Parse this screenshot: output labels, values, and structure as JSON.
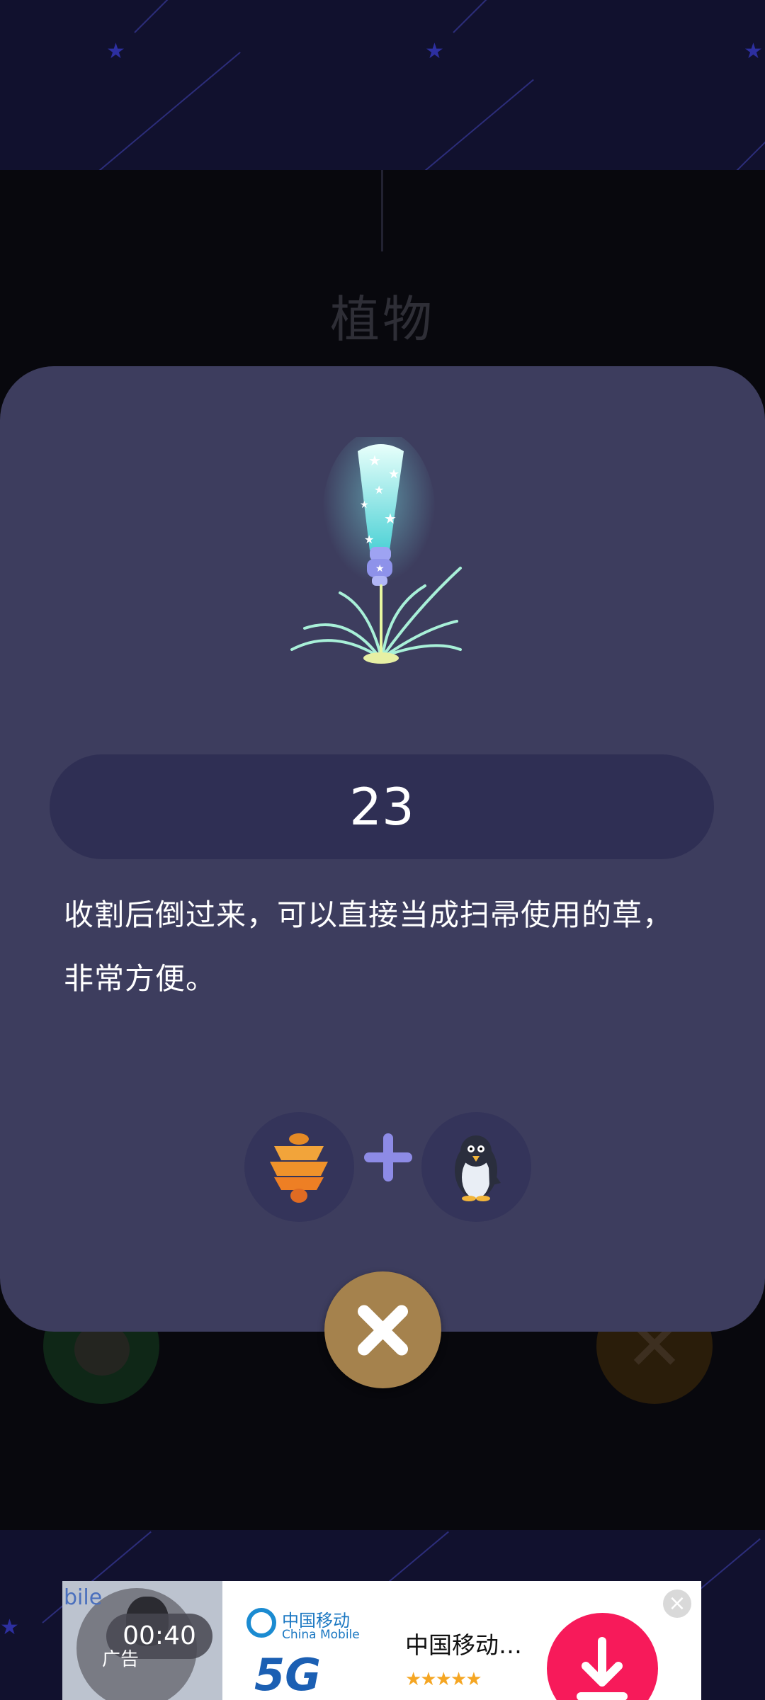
{
  "background": {
    "dimmed_title": "植物"
  },
  "modal": {
    "item_icon": "glowing-broom-grass",
    "count": "23",
    "description": "收割后倒过来，可以直接当成扫帚使用的草，非常方便。",
    "recipe": {
      "ingredients": [
        {
          "icon": "orange-lantern-icon"
        },
        {
          "icon": "penguin-icon"
        }
      ],
      "operator_icon": "plus-icon"
    },
    "close_icon": "close-icon"
  },
  "ad": {
    "video_time": "00:40",
    "ad_label": "广告",
    "video_overlay_text": "bile",
    "brand_cn": "中国移动",
    "brand_en": "China Mobile",
    "brand_5g": "5G",
    "title": "中国移动…",
    "rating_stars": "★★★★★",
    "close_label": "×"
  }
}
